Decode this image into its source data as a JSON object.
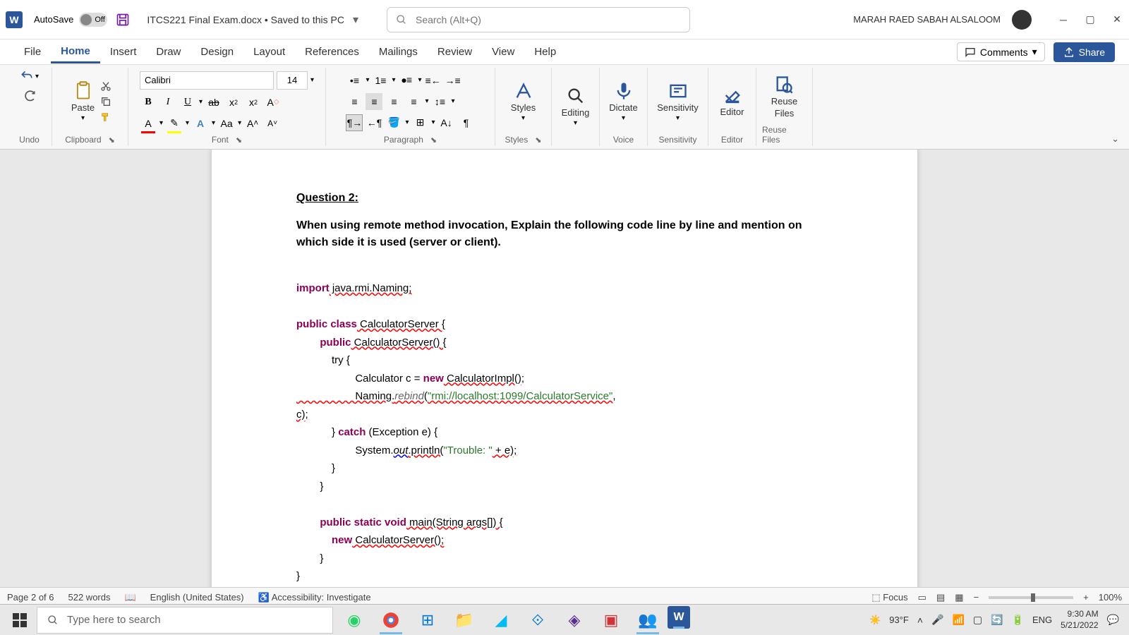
{
  "titlebar": {
    "autosave_label": "AutoSave",
    "autosave_state": "Off",
    "doc_title": "ITCS221 Final Exam.docx • Saved to this PC",
    "search_placeholder": "Search (Alt+Q)",
    "user_name": "MARAH RAED SABAH ALSALOOM"
  },
  "tabs": {
    "items": [
      "File",
      "Home",
      "Insert",
      "Draw",
      "Design",
      "Layout",
      "References",
      "Mailings",
      "Review",
      "View",
      "Help"
    ],
    "active_index": 1,
    "comments": "Comments",
    "share": "Share"
  },
  "ribbon": {
    "undo_label": "Undo",
    "clipboard_label": "Clipboard",
    "paste_label": "Paste",
    "font_name": "Calibri",
    "font_size": "14",
    "font_label": "Font",
    "paragraph_label": "Paragraph",
    "styles_label": "Styles",
    "styles_btn": "Styles",
    "editing_label": "Editing",
    "dictate_label": "Dictate",
    "voice_label": "Voice",
    "sensitivity_label": "Sensitivity",
    "sensitivity_group": "Sensitivity",
    "editor_label": "Editor",
    "editor_group": "Editor",
    "reuse_label": "Reuse Files",
    "reuse_btn_l1": "Reuse",
    "reuse_btn_l2": "Files"
  },
  "document": {
    "question_title": "Question 2:",
    "question_text": "When using remote method invocation, Explain the following code line by line and mention on which side it is used (server or client).",
    "code": {
      "l1_import": "import",
      "l1_rest": " java.rmi.Naming;",
      "l2_pub": "public",
      "l2_class": " class",
      "l2_rest": " CalculatorServer {",
      "l3_pub": "        public",
      "l3_rest": " CalculatorServer() {",
      "l4": "            try {",
      "l5_a": "                    Calculator c = ",
      "l5_new": "new",
      "l5_b": " CalculatorImpl();",
      "l6_a": "                    Naming.",
      "l6_rebind": "rebind",
      "l6_b": "(",
      "l6_str1": "\"rmi://localhost:1099/CalculatorService\"",
      "l6_c": ",",
      "l7": "c);",
      "l8_a": "            } ",
      "l8_catch": "catch",
      "l8_b": " (Exception e) {",
      "l9_a": "                    System.",
      "l9_out": "out",
      "l9_b": ".println(",
      "l9_str": "\"Trouble: \"",
      "l9_c": " + e);",
      "l10": "            }",
      "l11": "        }",
      "l12_pub": "        public",
      "l12_static": " static",
      "l12_void": " void",
      "l12_rest": " main(String args[]) {",
      "l13_new": "            new",
      "l13_rest": " CalculatorServer();",
      "l14": "        }",
      "l15": "}"
    }
  },
  "statusbar": {
    "page_info": "Page 2 of 6",
    "word_count": "522 words",
    "language": "English (United States)",
    "accessibility": "Accessibility: Investigate",
    "focus": "Focus",
    "zoom": "100%"
  },
  "taskbar": {
    "search_placeholder": "Type here to search",
    "weather": "93°F",
    "lang": "ENG",
    "time": "9:30 AM",
    "date": "5/21/2022"
  }
}
